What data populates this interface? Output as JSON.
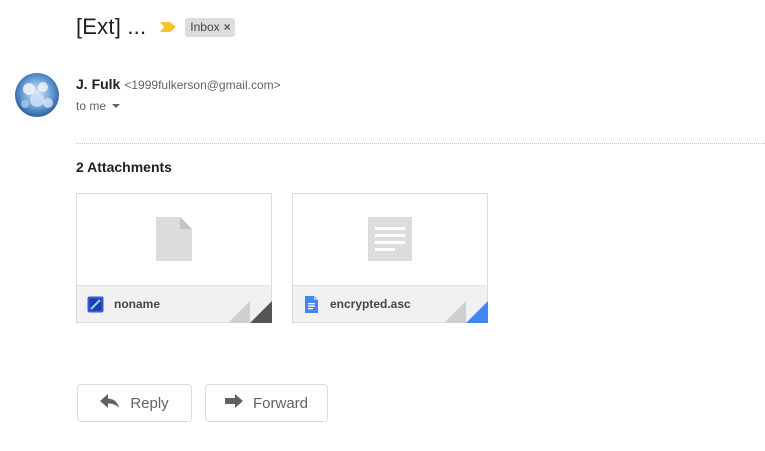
{
  "message": {
    "subject": "[Ext] ...",
    "importance_icon": "importance-marker-icon",
    "label": "Inbox",
    "label_remove": "×",
    "sender_name": "J. Fulk",
    "sender_email": "<1999fulkerson@gmail.com>",
    "recipient": "to me"
  },
  "attachments": {
    "heading": "2 Attachments",
    "items": [
      {
        "name": "noname",
        "preview_icon": "generic-file-icon",
        "type_icon": "image-file-icon",
        "accent": "#555555"
      },
      {
        "name": "encrypted.asc",
        "preview_icon": "text-document-icon",
        "type_icon": "docs-file-icon",
        "accent": "#4285f4"
      }
    ]
  },
  "actions": {
    "reply": "Reply",
    "forward": "Forward"
  },
  "colors": {
    "importance": "#f4c430",
    "docs_blue": "#4285f4",
    "image_icon_blue": "#1a73e8"
  }
}
